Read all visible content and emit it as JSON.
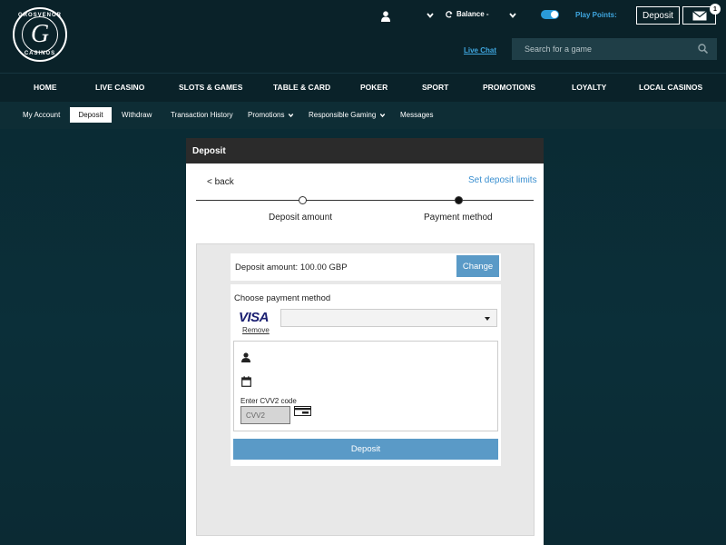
{
  "header": {
    "logo": {
      "ring_text_top": "GROSVENOR",
      "ring_text_bottom": "CASINOS",
      "letter": "G"
    },
    "balance_label": "Balance -",
    "play_points_label": "Play Points:",
    "deposit_button": "Deposit",
    "mail_badge_count": "1",
    "live_chat": "Live Chat",
    "search_placeholder": "Search for a game",
    "toggle_color": "#2a9bd8"
  },
  "main_nav": [
    "HOME",
    "LIVE CASINO",
    "SLOTS & GAMES",
    "TABLE & CARD",
    "POKER",
    "SPORT",
    "PROMOTIONS",
    "LOYALTY",
    "LOCAL CASINOS"
  ],
  "sub_nav": {
    "items": [
      "My Account",
      "Deposit",
      "Withdraw",
      "Transaction History",
      "Promotions",
      "Responsible Gaming",
      "Messages"
    ],
    "active": "Deposit"
  },
  "deposit": {
    "title": "Deposit",
    "back": "< back",
    "set_limits": "Set deposit limits",
    "steps": [
      "Deposit amount",
      "Payment method"
    ],
    "amount_text": "Deposit amount: 100.00 GBP",
    "change_button": "Change",
    "choose_method": "Choose payment method",
    "card_brand": "VISA",
    "remove": "Remove",
    "cvv_label": "Enter CVV2 code",
    "cvv_placeholder": "CVV2",
    "submit_button": "Deposit",
    "accent_color": "#5a9ac7"
  }
}
